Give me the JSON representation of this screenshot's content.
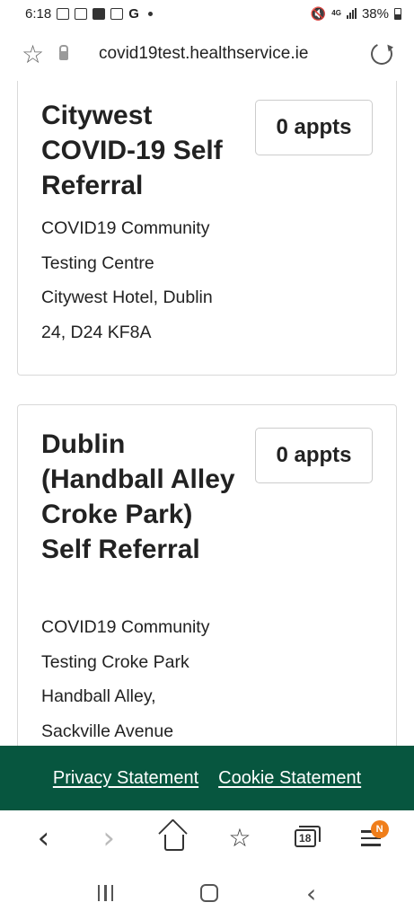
{
  "status_bar": {
    "time": "6:18",
    "battery": "38%",
    "network": "4G"
  },
  "url_bar": {
    "url": "covid19test.healthservice.ie"
  },
  "cards": [
    {
      "title": "Citywest COVID-19 Self Referral",
      "appts": "0 appts",
      "address_lines": [
        "COVID19 Community",
        "Testing Centre",
        "Citywest Hotel, Dublin",
        "24, D24 KF8A"
      ]
    },
    {
      "title": "Dublin (Handball Alley Croke Park) Self Referral",
      "appts": "0 appts",
      "address_lines": [
        "COVID19 Community",
        "Testing Croke Park",
        "Handball Alley,",
        "Sackville Avenue"
      ]
    }
  ],
  "footer": {
    "privacy": "Privacy Statement",
    "cookie": "Cookie Statement"
  },
  "browser_nav": {
    "tabs_count": "18",
    "menu_badge": "N"
  },
  "colors": {
    "footer_bg": "#07563f",
    "badge": "#f07e1a"
  }
}
